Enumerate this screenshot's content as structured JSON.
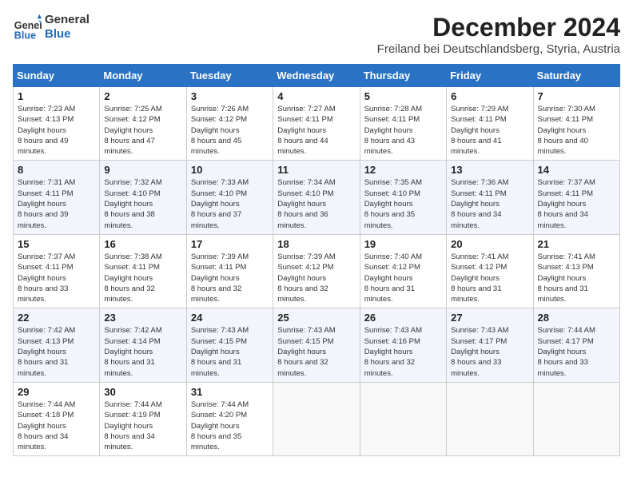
{
  "header": {
    "logo_general": "General",
    "logo_blue": "Blue",
    "month_title": "December 2024",
    "location": "Freiland bei Deutschlandsberg, Styria, Austria"
  },
  "weekdays": [
    "Sunday",
    "Monday",
    "Tuesday",
    "Wednesday",
    "Thursday",
    "Friday",
    "Saturday"
  ],
  "weeks": [
    [
      {
        "day": "1",
        "sunrise": "7:23 AM",
        "sunset": "4:13 PM",
        "daylight": "8 hours and 49 minutes."
      },
      {
        "day": "2",
        "sunrise": "7:25 AM",
        "sunset": "4:12 PM",
        "daylight": "8 hours and 47 minutes."
      },
      {
        "day": "3",
        "sunrise": "7:26 AM",
        "sunset": "4:12 PM",
        "daylight": "8 hours and 45 minutes."
      },
      {
        "day": "4",
        "sunrise": "7:27 AM",
        "sunset": "4:11 PM",
        "daylight": "8 hours and 44 minutes."
      },
      {
        "day": "5",
        "sunrise": "7:28 AM",
        "sunset": "4:11 PM",
        "daylight": "8 hours and 43 minutes."
      },
      {
        "day": "6",
        "sunrise": "7:29 AM",
        "sunset": "4:11 PM",
        "daylight": "8 hours and 41 minutes."
      },
      {
        "day": "7",
        "sunrise": "7:30 AM",
        "sunset": "4:11 PM",
        "daylight": "8 hours and 40 minutes."
      }
    ],
    [
      {
        "day": "8",
        "sunrise": "7:31 AM",
        "sunset": "4:11 PM",
        "daylight": "8 hours and 39 minutes."
      },
      {
        "day": "9",
        "sunrise": "7:32 AM",
        "sunset": "4:10 PM",
        "daylight": "8 hours and 38 minutes."
      },
      {
        "day": "10",
        "sunrise": "7:33 AM",
        "sunset": "4:10 PM",
        "daylight": "8 hours and 37 minutes."
      },
      {
        "day": "11",
        "sunrise": "7:34 AM",
        "sunset": "4:10 PM",
        "daylight": "8 hours and 36 minutes."
      },
      {
        "day": "12",
        "sunrise": "7:35 AM",
        "sunset": "4:10 PM",
        "daylight": "8 hours and 35 minutes."
      },
      {
        "day": "13",
        "sunrise": "7:36 AM",
        "sunset": "4:11 PM",
        "daylight": "8 hours and 34 minutes."
      },
      {
        "day": "14",
        "sunrise": "7:37 AM",
        "sunset": "4:11 PM",
        "daylight": "8 hours and 34 minutes."
      }
    ],
    [
      {
        "day": "15",
        "sunrise": "7:37 AM",
        "sunset": "4:11 PM",
        "daylight": "8 hours and 33 minutes."
      },
      {
        "day": "16",
        "sunrise": "7:38 AM",
        "sunset": "4:11 PM",
        "daylight": "8 hours and 32 minutes."
      },
      {
        "day": "17",
        "sunrise": "7:39 AM",
        "sunset": "4:11 PM",
        "daylight": "8 hours and 32 minutes."
      },
      {
        "day": "18",
        "sunrise": "7:39 AM",
        "sunset": "4:12 PM",
        "daylight": "8 hours and 32 minutes."
      },
      {
        "day": "19",
        "sunrise": "7:40 AM",
        "sunset": "4:12 PM",
        "daylight": "8 hours and 31 minutes."
      },
      {
        "day": "20",
        "sunrise": "7:41 AM",
        "sunset": "4:12 PM",
        "daylight": "8 hours and 31 minutes."
      },
      {
        "day": "21",
        "sunrise": "7:41 AM",
        "sunset": "4:13 PM",
        "daylight": "8 hours and 31 minutes."
      }
    ],
    [
      {
        "day": "22",
        "sunrise": "7:42 AM",
        "sunset": "4:13 PM",
        "daylight": "8 hours and 31 minutes."
      },
      {
        "day": "23",
        "sunrise": "7:42 AM",
        "sunset": "4:14 PM",
        "daylight": "8 hours and 31 minutes."
      },
      {
        "day": "24",
        "sunrise": "7:43 AM",
        "sunset": "4:15 PM",
        "daylight": "8 hours and 31 minutes."
      },
      {
        "day": "25",
        "sunrise": "7:43 AM",
        "sunset": "4:15 PM",
        "daylight": "8 hours and 32 minutes."
      },
      {
        "day": "26",
        "sunrise": "7:43 AM",
        "sunset": "4:16 PM",
        "daylight": "8 hours and 32 minutes."
      },
      {
        "day": "27",
        "sunrise": "7:43 AM",
        "sunset": "4:17 PM",
        "daylight": "8 hours and 33 minutes."
      },
      {
        "day": "28",
        "sunrise": "7:44 AM",
        "sunset": "4:17 PM",
        "daylight": "8 hours and 33 minutes."
      }
    ],
    [
      {
        "day": "29",
        "sunrise": "7:44 AM",
        "sunset": "4:18 PM",
        "daylight": "8 hours and 34 minutes."
      },
      {
        "day": "30",
        "sunrise": "7:44 AM",
        "sunset": "4:19 PM",
        "daylight": "8 hours and 34 minutes."
      },
      {
        "day": "31",
        "sunrise": "7:44 AM",
        "sunset": "4:20 PM",
        "daylight": "8 hours and 35 minutes."
      },
      null,
      null,
      null,
      null
    ]
  ],
  "labels": {
    "sunrise": "Sunrise:",
    "sunset": "Sunset:",
    "daylight": "Daylight hours"
  }
}
